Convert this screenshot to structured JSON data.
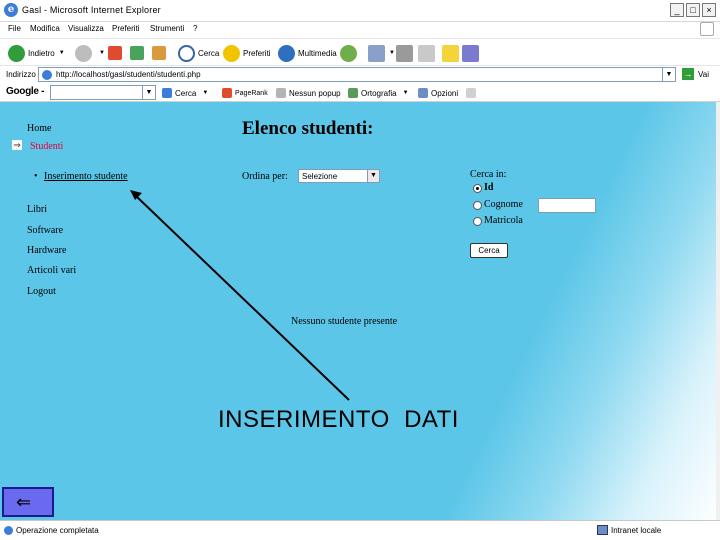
{
  "window": {
    "title": "Gasl - Microsoft Internet Explorer",
    "buttons": [
      "_",
      "□",
      "×"
    ]
  },
  "menubar": {
    "items": [
      "File",
      "Modifica",
      "Visualizza",
      "Preferiti",
      "Strumenti",
      "?"
    ]
  },
  "toolbar": {
    "back_label": "Indietro",
    "search_label": "Cerca",
    "favorites_label": "Preferiti",
    "multimedia_label": "Multimedia"
  },
  "addressbar": {
    "label": "Indirizzo",
    "url": "http://localhost/gasl/studenti/studenti.php",
    "go_label": "Vai"
  },
  "googlebar": {
    "logo": "Google -",
    "search_label": "Cerca",
    "pagerank_label": "PageRank",
    "popup_label": "Nessun popup",
    "spelling_label": "Ortografia",
    "options_label": "Opzioni"
  },
  "nav": {
    "home": "Home",
    "studenti": "Studenti",
    "inserimento": "Inserimento studente",
    "libri": "Libri",
    "software": "Software",
    "hardware": "Hardware",
    "articoli": "Articoli vari",
    "logout": "Logout"
  },
  "main": {
    "title": "Elenco studenti:",
    "sort_label": "Ordina per:",
    "sort_value": "Selezione",
    "search_label": "Cerca in:",
    "radio_options": [
      "Id",
      "Cognome",
      "Matricola"
    ],
    "selected_radio": "Id",
    "search_button": "Cerca",
    "empty_message": "Nessuno studente presente"
  },
  "annotation": {
    "text": "INSERIMENTO  DATI"
  },
  "status": {
    "message": "Operazione completata",
    "zone": "Intranet locale"
  }
}
